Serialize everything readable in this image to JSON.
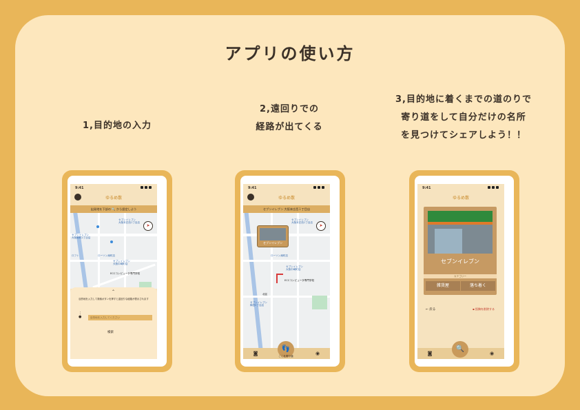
{
  "title": "アプリの使い方",
  "steps": {
    "s1": {
      "line1": "1,目的地の入力"
    },
    "s2": {
      "line1": "2,遠回りでの",
      "line2": "経路が出てくる"
    },
    "s3": {
      "line1": "3,目的地に着くまでの道のりで",
      "line2": "寄り道をして自分だけの名所",
      "line3": "を見つけてシェアしよう！！"
    }
  },
  "phone": {
    "time": "9:41",
    "logo": "ゆるめ散",
    "loc_label": "現在地",
    "map_labels": [
      "セブンイレブン",
      "大阪本庄西1丁目店",
      "セブンイレブン",
      "大阪扇町2丁目店",
      "ローソン扇町店",
      "セブンイレブン",
      "大阪中崎町店",
      "ローソン",
      "ECCコンピュータ専門学校",
      "北区",
      "セブンイレブン",
      "梅田5丁目店",
      "ロフト"
    ]
  },
  "screen1": {
    "search_hint": "出発地を下部の 🔍 から設定しよう",
    "sheet_note": "目的地を入力して検索ボタンを押すと遠回りな経路が表示されます",
    "dest_placeholder": "目的地を入力してください",
    "search_label": "検索"
  },
  "screen2": {
    "search_hint": "セブンイレブン 大阪本庄西１丁目店",
    "popup_name": "セブンイレブン",
    "fab_label": "ここを寄り道"
  },
  "screen3": {
    "store_name": "セブンイレブン",
    "category": "カテゴリー",
    "tag1": "雑貨屋",
    "tag2": "落ち着く",
    "back": "戻る",
    "remove": "投稿を削除する"
  }
}
